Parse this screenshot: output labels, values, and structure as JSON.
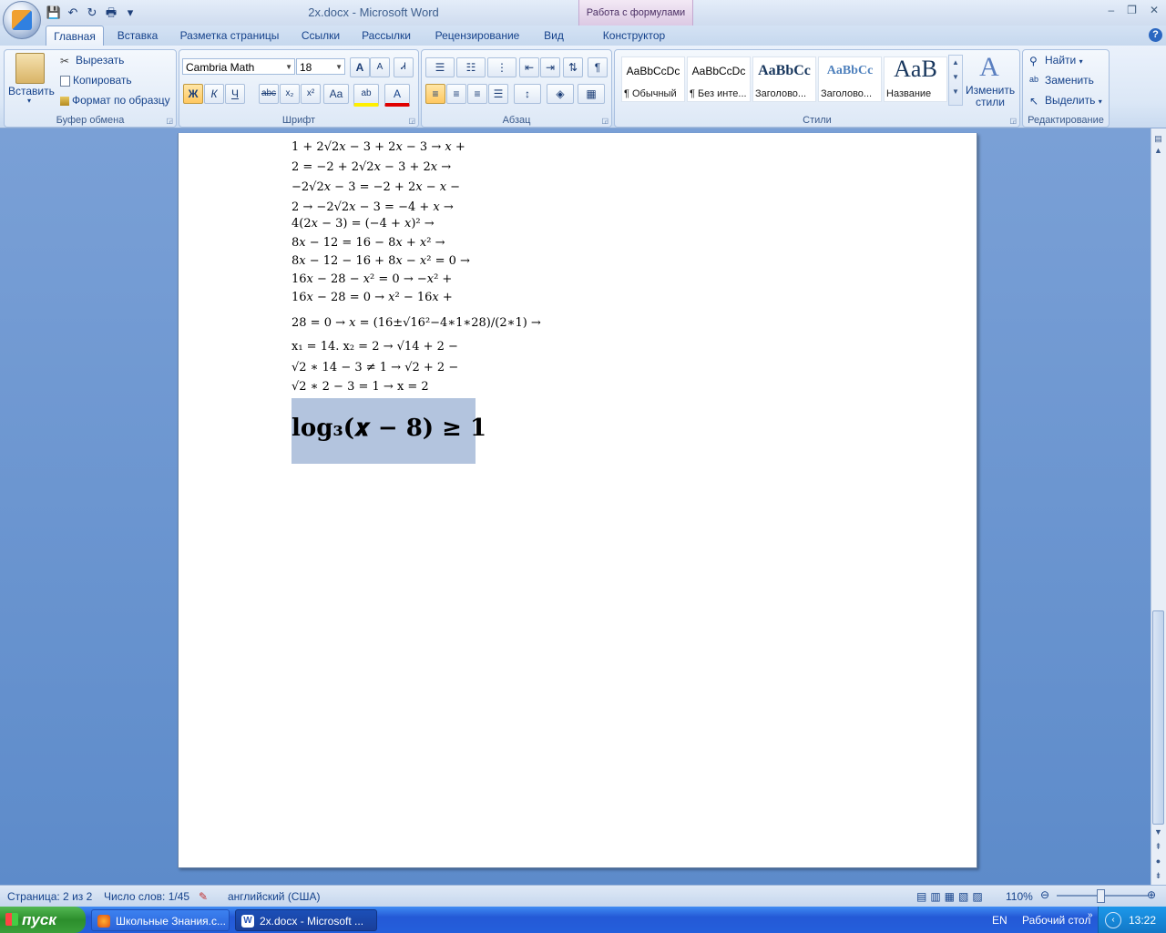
{
  "window": {
    "title": "2x.docx - Microsoft Word",
    "context_tab_title": "Работа с формулами",
    "controls": [
      "–",
      "❐",
      "✕"
    ]
  },
  "qat": {
    "save": "💾",
    "undo": "↶",
    "redo": "↻",
    "print": "🖶",
    "more": "▾"
  },
  "tabs": [
    "Главная",
    "Вставка",
    "Разметка страницы",
    "Ссылки",
    "Рассылки",
    "Рецензирование",
    "Вид",
    "Конструктор"
  ],
  "help": "?",
  "clipboard": {
    "paste": "Вставить",
    "cut": "Вырезать",
    "copy": "Копировать",
    "format_painter": "Формат по образцу",
    "group": "Буфер обмена"
  },
  "font": {
    "name": "Cambria Math",
    "size": "18",
    "grow": "A",
    "shrink": "A",
    "clear": "Ꮧ",
    "bold": "Ж",
    "italic": "К",
    "underline": "Ч",
    "strike": "abc",
    "subscript": "x₂",
    "superscript": "x²",
    "case": "Aa",
    "highlight": "ab",
    "color": "A",
    "group": "Шрифт"
  },
  "paragraph": {
    "group": "Абзац",
    "pilcrow": "¶"
  },
  "styles": {
    "items": [
      {
        "sample": "AaBbCcDc",
        "name": "¶ Обычный"
      },
      {
        "sample": "AaBbCcDc",
        "name": "¶ Без инте..."
      },
      {
        "sample": "AaBbCc",
        "name": "Заголово..."
      },
      {
        "sample": "AaBbCc",
        "name": "Заголово..."
      },
      {
        "sample": "AaB",
        "name": "Название"
      }
    ],
    "change": "Изменить стили",
    "group": "Стили"
  },
  "editing": {
    "find": "Найти",
    "replace": "Заменить",
    "select": "Выделить",
    "group": "Редактирование"
  },
  "document": {
    "lines": [
      "1 + 2√2𝑥 − 3 + 2𝑥 − 3 → 𝑥 +",
      "2 = −2 + 2√2𝑥 − 3 + 2𝑥 →",
      "−2√2𝑥 − 3 = −2 + 2𝑥 − 𝑥 −",
      "2 → −2√2𝑥 − 3 = −4 + 𝑥 →",
      "4(2𝑥 − 3) = (−4 + 𝑥)² →",
      "8𝑥 − 12 = 16 − 8𝑥 + 𝑥² →",
      "8𝑥 − 12 − 16 + 8𝑥 − 𝑥² = 0 →",
      "16𝑥 − 28 − 𝑥² = 0 → −𝑥² +",
      "16𝑥 − 28 = 0 → 𝑥² − 16𝑥 +",
      "28 = 0 → 𝑥 = (16±√16²−4∗1∗28)/(2∗1) →",
      "x₁ = 14. x₂ = 2 → √14 + 2 −",
      "√2 ∗ 14 − 3 ≠ 1 → √2 + 2 −",
      "√2 ∗ 2 − 3 = 1 → x = 2"
    ],
    "selected_formula": "log₃(𝒙 − 8) ≥ 1"
  },
  "status": {
    "page": "Страница: 2 из 2",
    "words": "Число слов: 1/45",
    "language": "английский (США)",
    "zoom": "110%"
  },
  "taskbar": {
    "start": "пуск",
    "items": [
      "Школьные Знания.c...",
      "2x.docx - Microsoft ..."
    ],
    "lang": "EN",
    "desktop": "Рабочий стол",
    "clock": "13:22"
  }
}
